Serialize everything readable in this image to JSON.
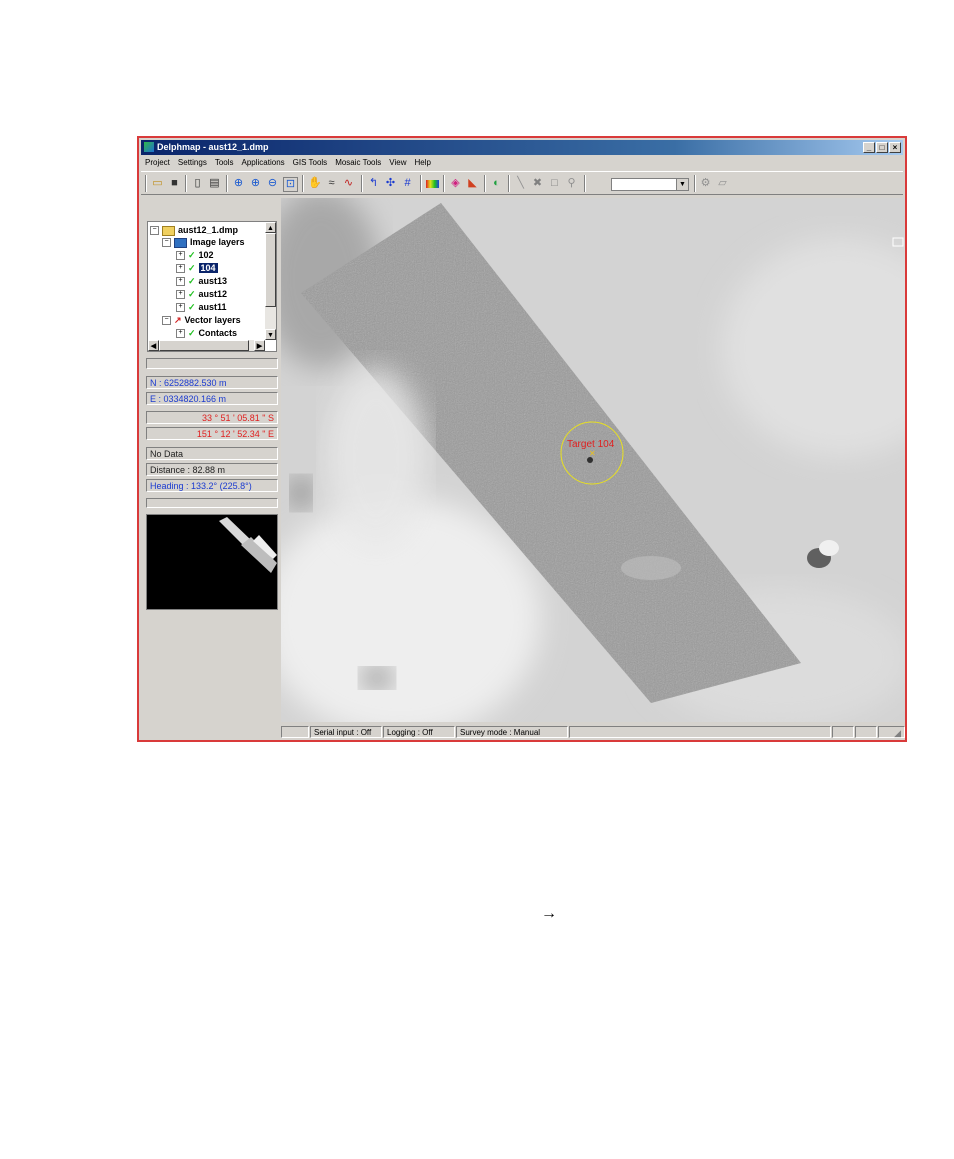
{
  "window": {
    "title": "Delphmap - aust12_1.dmp",
    "controls": {
      "minimize": "_",
      "maximize": "□",
      "close": "×"
    }
  },
  "menu": [
    "Project",
    "Settings",
    "Tools",
    "Applications",
    "GIS Tools",
    "Mosaic Tools",
    "View",
    "Help"
  ],
  "toolbar": {
    "icons": [
      "open-icon",
      "save-icon",
      "print-preview-icon",
      "print-icon",
      "zoom-select-icon",
      "zoom-in-icon",
      "zoom-out-icon",
      "zoom-extent-icon",
      "pan-icon",
      "measure-icon",
      "profile-icon",
      "annotate-icon",
      "target-icon",
      "grid-icon",
      "color-bar-icon",
      "palette-icon",
      "layer-icon",
      "export-icon",
      "line-icon",
      "delete-icon",
      "rectangle-icon",
      "tool-icon",
      "settings-icon",
      "folder-icon"
    ],
    "combo_value": ""
  },
  "tree": {
    "root": "aust12_1.dmp",
    "image_group": "Image layers",
    "image_layers": [
      "102",
      "104",
      "aust13",
      "aust12",
      "aust11"
    ],
    "selected": "104",
    "vector_group": "Vector layers",
    "vector_layers": [
      "Contacts"
    ]
  },
  "readouts": {
    "northing": "N : 6252882.530 m",
    "easting": "E : 0334820.166 m",
    "latitude": "33 ° 51 ' 05.81 \" S",
    "longitude": "151 ° 12 ' 52.34 \" E",
    "data": "No Data",
    "distance": "Distance : 82.88 m",
    "heading": "Heading : 133.2° (225.8°)"
  },
  "map": {
    "target_label": "Target 104",
    "target_color": "#e02020",
    "circle_color": "#e8e020"
  },
  "status": {
    "serial": "Serial input : Off",
    "logging": "Logging : Off",
    "survey": "Survey mode : Manual"
  },
  "page": {
    "arrow": "→"
  },
  "colors": {
    "title_bar": "#0a246a",
    "window_border": "#d93a3a",
    "readout_blue": "#1a3ad0",
    "readout_red": "#e02020"
  }
}
